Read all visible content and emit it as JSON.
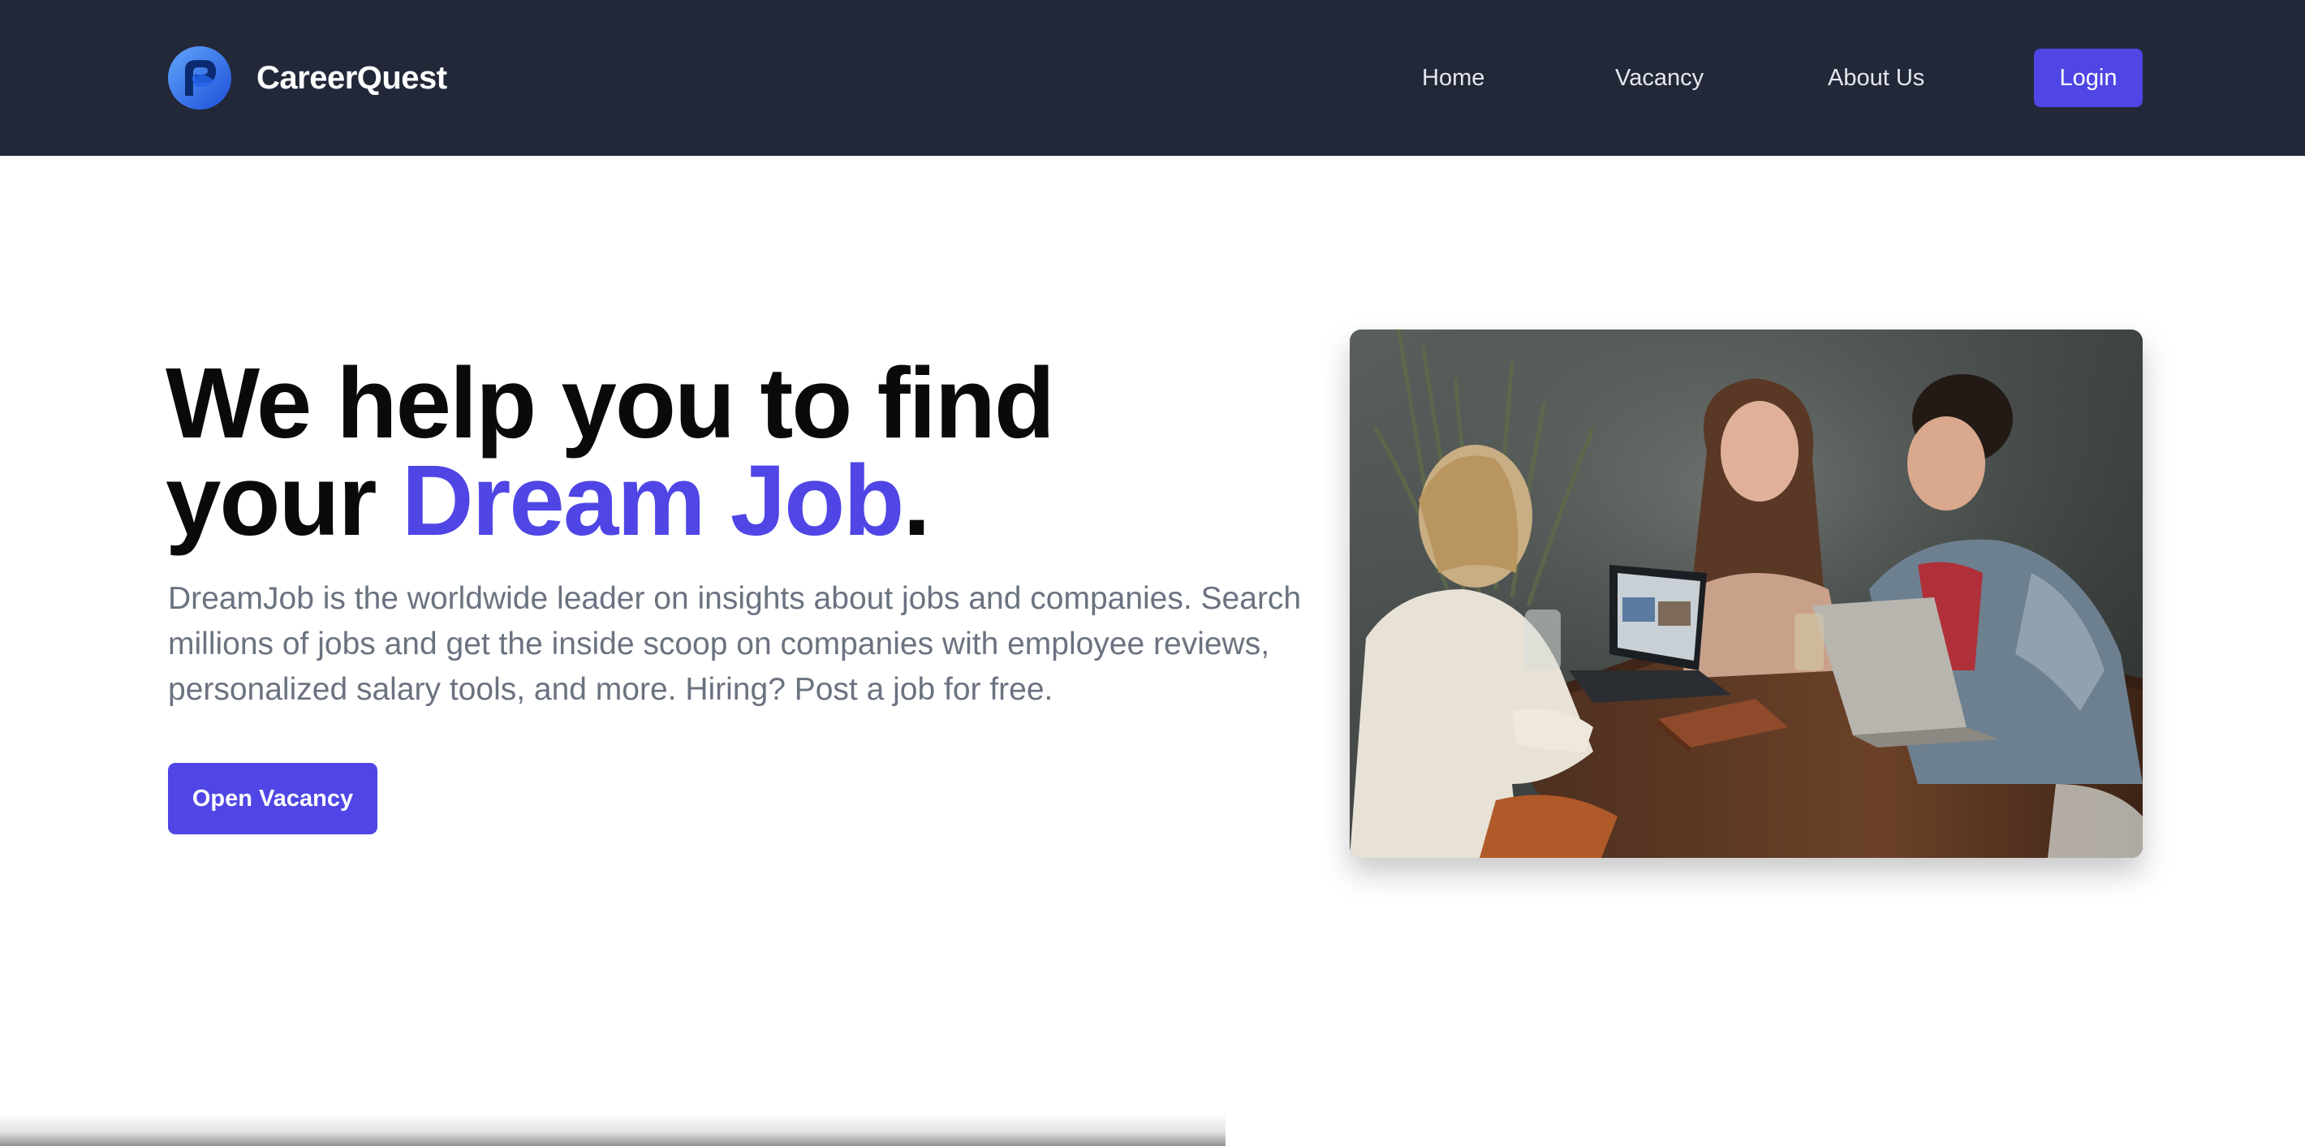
{
  "brand": {
    "name": "CareerQuest",
    "logo_icon": "swirl-logo-icon",
    "logo_colors": [
      "#1d4ed8",
      "#3b82f6",
      "#0b2a6f"
    ]
  },
  "nav": {
    "items": [
      {
        "label": "Home"
      },
      {
        "label": "Vacancy"
      },
      {
        "label": "About Us"
      }
    ],
    "login_label": "Login"
  },
  "hero": {
    "title_line1": "We help you to find",
    "title_prefix": "your ",
    "title_highlight": "Dream Job",
    "title_suffix": ".",
    "description": "DreamJob is the worldwide leader on insights about jobs and companies. Search millions of jobs and get the inside scoop on companies with employee reviews, personalized salary tools, and more. Hiring? Post a job for free.",
    "cta_label": "Open Vacancy",
    "image_subject": "three-people-laughing-at-table-with-laptops"
  },
  "colors": {
    "navbar_bg": "#222838",
    "accent": "#4f46e5",
    "title_text": "#0a0a0a",
    "body_text": "#6b7280"
  }
}
